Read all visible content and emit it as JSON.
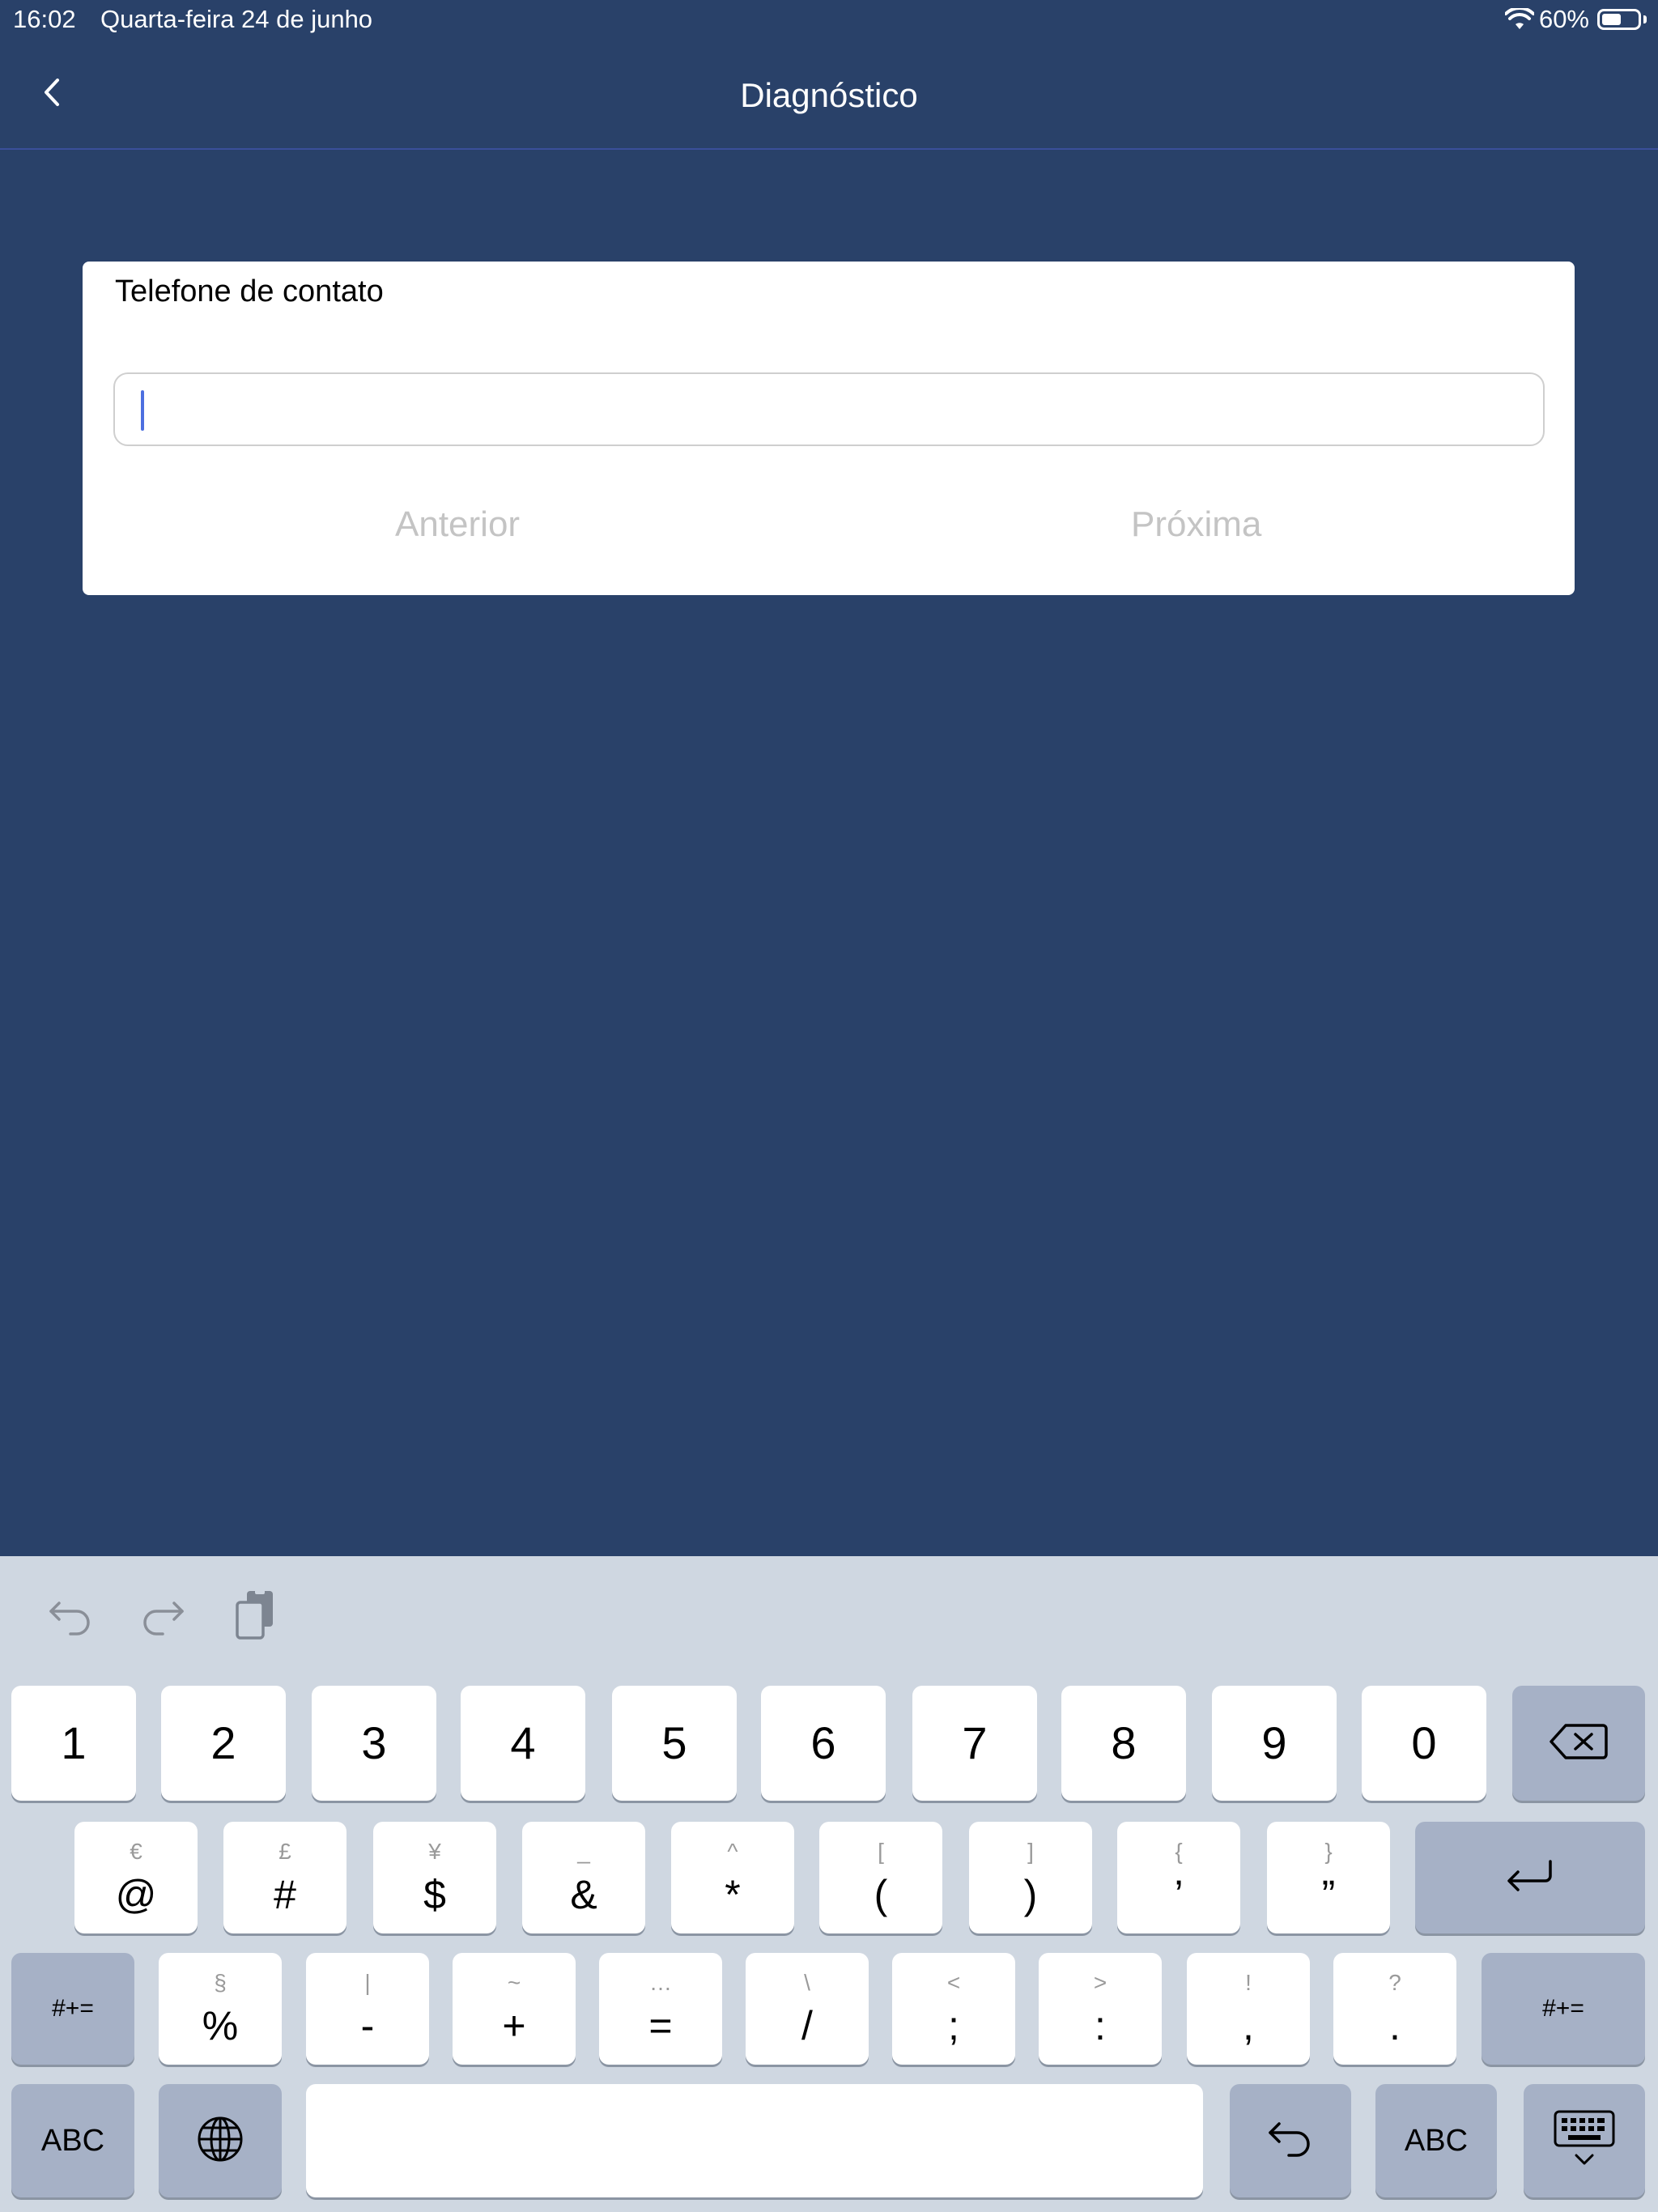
{
  "status_bar": {
    "time": "16:02",
    "date": "Quarta-feira 24 de junho",
    "battery": "60%",
    "battery_level": 0.6
  },
  "nav": {
    "title": "Diagnóstico",
    "back_icon": "chevron-left-icon"
  },
  "form": {
    "label": "Telefone de contato",
    "value": "",
    "prev_label": "Anterior",
    "next_label": "Próxima"
  },
  "keyboard": {
    "toolbar": [
      "undo-icon",
      "redo-icon",
      "clipboard-icon"
    ],
    "row1": [
      "1",
      "2",
      "3",
      "4",
      "5",
      "6",
      "7",
      "8",
      "9",
      "0"
    ],
    "row2": [
      {
        "main": "@",
        "sec": "€"
      },
      {
        "main": "#",
        "sec": "£"
      },
      {
        "main": "$",
        "sec": "¥"
      },
      {
        "main": "&",
        "sec": "_"
      },
      {
        "main": "*",
        "sec": "^"
      },
      {
        "main": "(",
        "sec": "["
      },
      {
        "main": ")",
        "sec": "]"
      },
      {
        "main": "’",
        "sec": "{"
      },
      {
        "main": "”",
        "sec": "}"
      }
    ],
    "row3": [
      {
        "main": "%",
        "sec": "§"
      },
      {
        "main": "-",
        "sec": "|"
      },
      {
        "main": "+",
        "sec": "~"
      },
      {
        "main": "=",
        "sec": "…"
      },
      {
        "main": "/",
        "sec": "\\"
      },
      {
        "main": ";",
        "sec": "<"
      },
      {
        "main": ":",
        "sec": ">"
      },
      {
        "main": ",",
        "sec": "!"
      },
      {
        "main": ".",
        "sec": "?"
      }
    ],
    "symbols_key": "#+=",
    "abc_key": "ABC",
    "backspace_icon": "backspace-icon",
    "return_icon": "return-icon",
    "globe_icon": "globe-icon",
    "undo_key_icon": "undo-icon",
    "dismiss_icon": "keyboard-dismiss-icon"
  }
}
